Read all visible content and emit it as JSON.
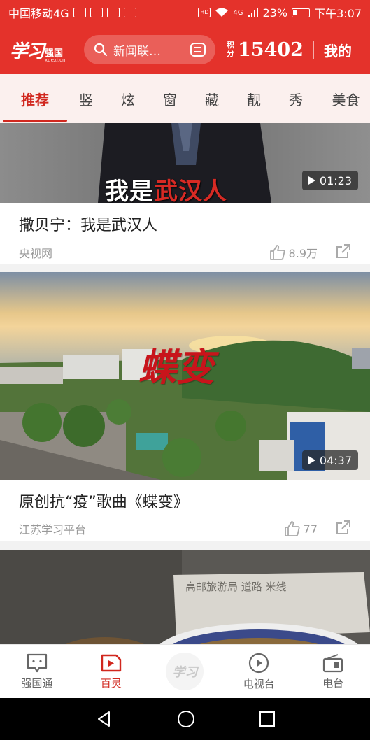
{
  "status_bar": {
    "carrier": "中国移动4G",
    "network": "4G",
    "battery": "23%",
    "time": "下午3:07"
  },
  "header": {
    "logo_text": "学习",
    "logo_sub": "强国",
    "logo_url": "xuexi.cn",
    "search_placeholder": "新闻联…",
    "score_label": "积分",
    "score_value": "15402",
    "mine_label": "我的"
  },
  "tabs": [
    "推荐",
    "竖",
    "炫",
    "窗",
    "藏",
    "靓",
    "秀",
    "美食"
  ],
  "active_tab": 0,
  "feed": [
    {
      "overlay_caption_1": "我是",
      "overlay_caption_2": "武汉人",
      "duration": "01:23",
      "title": "撒贝宁：我是武汉人",
      "source": "央视网",
      "likes": "8.9万"
    },
    {
      "overlay_caption": "蝶变",
      "duration": "04:37",
      "title": "原创抗“疫”歌曲《蝶变》",
      "source": "江苏学习平台",
      "likes": "77"
    },
    {
      "overlay_caption": "高邮旅游局 道路 米线",
      "duration": "",
      "title": "",
      "source": "",
      "likes": ""
    }
  ],
  "bottom_nav": [
    {
      "label": "强国通",
      "icon": "chat-icon"
    },
    {
      "label": "百灵",
      "icon": "video-icon"
    },
    {
      "label": "学习",
      "icon": "study-logo-icon"
    },
    {
      "label": "电视台",
      "icon": "play-circle-icon"
    },
    {
      "label": "电台",
      "icon": "radio-icon"
    }
  ],
  "colors": {
    "brand_red": "#e4322b",
    "active_red": "#d1281f"
  }
}
